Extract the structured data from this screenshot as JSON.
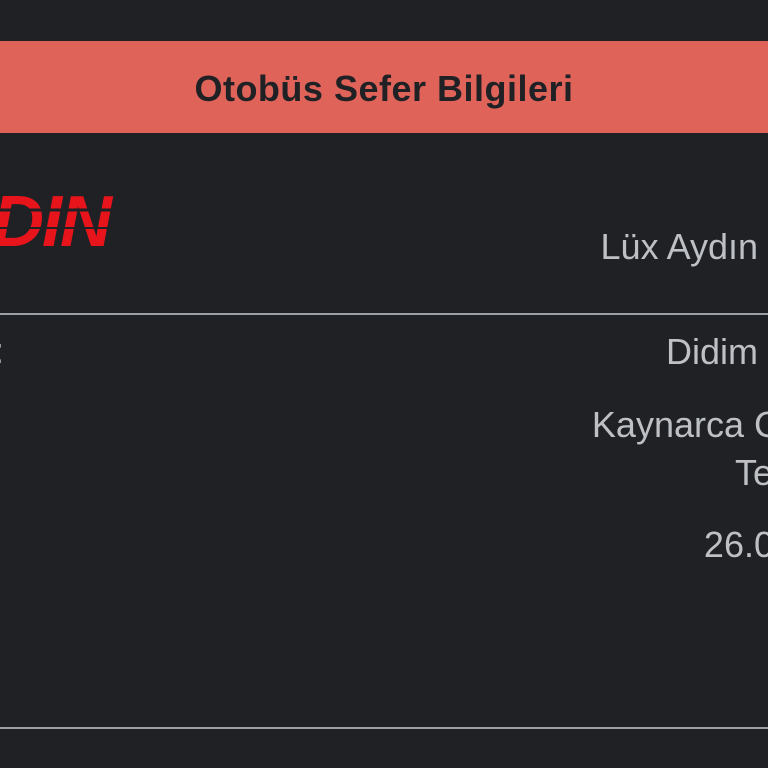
{
  "header": {
    "title": "Otobüs Sefer Bilgileri"
  },
  "company": {
    "logo_text": "DIN",
    "name": "Lüx Aydın"
  },
  "details": {
    "row_label": ":",
    "departure": "Didim",
    "address_line1": "Kaynarca C",
    "address_line2": "Te",
    "date": "26.0"
  },
  "colors": {
    "header_bg": "#e0635a",
    "page_bg": "#202124",
    "text": "#bdc1c6",
    "logo": "#e8141c"
  }
}
